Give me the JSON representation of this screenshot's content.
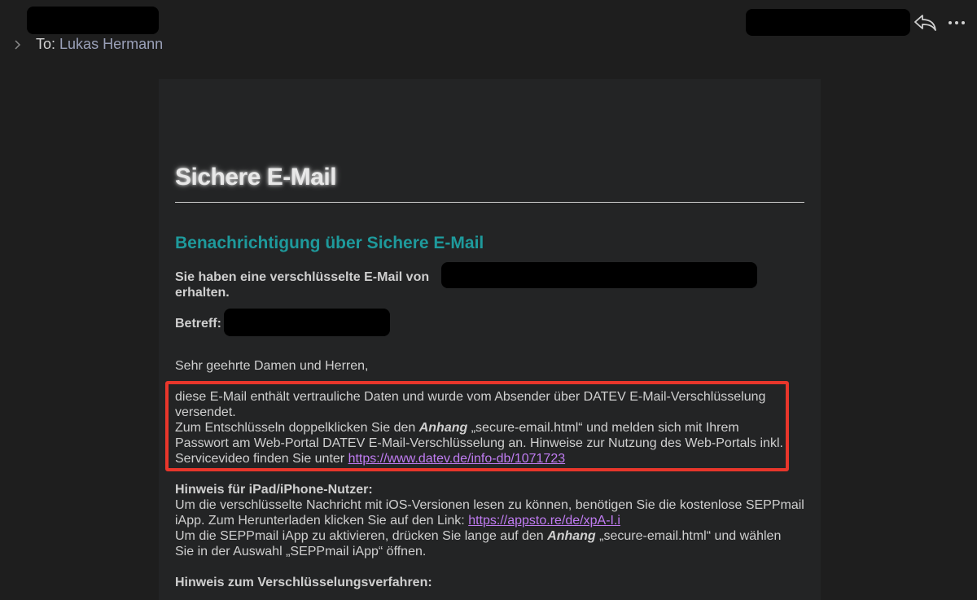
{
  "header": {
    "icons": [
      "reply-icon",
      "more-icon",
      "chevron-right-icon"
    ],
    "to_label": "To:",
    "to_name": "Lukas Hermann"
  },
  "email": {
    "title": "Sichere E-Mail",
    "heading": "Benachrichtigung über Sichere E-Mail",
    "received_line1": "Sie haben eine verschlüsselte E-Mail von",
    "received_line2": "erhalten.",
    "subject_label": "Betreff:",
    "greeting": "Sehr geehrte Damen und Herren,",
    "body": {
      "l1": "diese E-Mail enthält vertrauliche Daten und wurde vom Absender über DATEV E-Mail-Verschlüsselung",
      "l2": "versendet.",
      "l3a": "Zum Entschlüsseln doppelklicken Sie den ",
      "l3_italic": "Anhang",
      "l3b": " „secure-email.html“ und melden sich mit Ihrem",
      "l4": "Passwort am Web-Portal DATEV E-Mail-Verschlüsselung an. Hinweise zur Nutzung des Web-Portals inkl.",
      "l5a": "Servicevideo finden Sie unter ",
      "l5_link": "https://www.datev.de/info-db/1071723"
    },
    "ipad": {
      "heading": "Hinweis für iPad/iPhone-Nutzer:",
      "l1": "Um die verschlüsselte Nachricht mit iOS-Versionen lesen zu können, benötigen Sie die kostenlose SEPPmail",
      "l2a": "iApp. Zum Herunterladen klicken Sie auf den Link: ",
      "l2_link": "https://appsto.re/de/xpA-I.i",
      "l3a": "Um die SEPPmail iApp zu aktivieren, drücken Sie lange auf den ",
      "l3_italic": "Anhang",
      "l3b": " „secure-email.html“ und wählen",
      "l4": "Sie in der Auswahl „SEPPmail iApp“ öffnen."
    },
    "encryption_heading": "Hinweis zum Verschlüsselungsverfahren:"
  }
}
